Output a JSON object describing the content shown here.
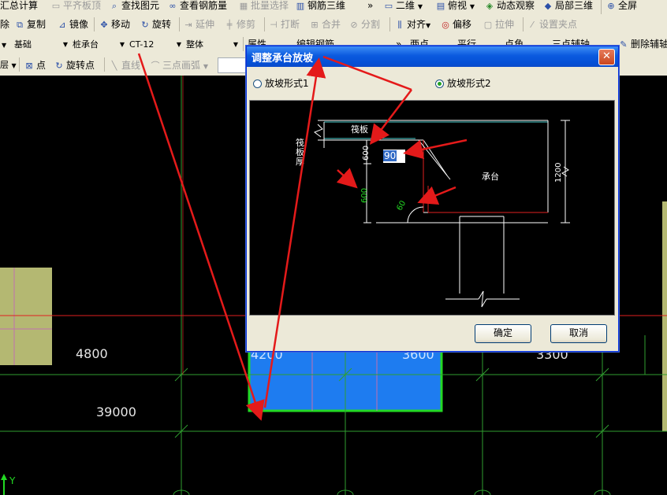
{
  "toolbar1": {
    "items": [
      {
        "label": "汇总计算",
        "icon": "calc-icon",
        "disabled": false
      },
      {
        "label": "平齐板顶",
        "icon": "align-top-icon",
        "disabled": true
      },
      {
        "label": "查找图元",
        "icon": "find-icon",
        "disabled": false
      },
      {
        "label": "查看钢筋量",
        "icon": "rebar-qty-icon",
        "disabled": false
      },
      {
        "label": "批量选择",
        "icon": "batch-select-icon",
        "disabled": true
      },
      {
        "label": "钢筋三维",
        "icon": "rebar-3d-icon",
        "disabled": false
      },
      {
        "label": "二维",
        "icon": "2d-icon",
        "disabled": false
      },
      {
        "label": "俯视",
        "icon": "top-view-icon",
        "disabled": false
      },
      {
        "label": "动态观察",
        "icon": "orbit-icon",
        "disabled": false
      },
      {
        "label": "局部三维",
        "icon": "local-3d-icon",
        "disabled": false
      },
      {
        "label": "全屏",
        "icon": "fullscreen-icon",
        "disabled": false
      }
    ]
  },
  "toolbar2": {
    "items": [
      {
        "label": "除",
        "disabled": false
      },
      {
        "label": "复制",
        "disabled": false
      },
      {
        "label": "镜像",
        "disabled": false
      },
      {
        "label": "移动",
        "disabled": false
      },
      {
        "label": "旋转",
        "disabled": false
      },
      {
        "label": "延伸",
        "disabled": true
      },
      {
        "label": "修剪",
        "disabled": true
      },
      {
        "label": "打断",
        "disabled": true
      },
      {
        "label": "合并",
        "disabled": true
      },
      {
        "label": "分割",
        "disabled": true
      },
      {
        "label": "对齐",
        "disabled": false
      },
      {
        "label": "偏移",
        "disabled": false
      },
      {
        "label": "拉伸",
        "disabled": true
      },
      {
        "label": "设置夹点",
        "disabled": true
      }
    ]
  },
  "toolbar3": {
    "combos": [
      "基础",
      "桩承台",
      "CT-12",
      "整体"
    ],
    "extra": [
      "属性",
      "编辑钢筋",
      "两点",
      "平行",
      "点角",
      "三点辅轴",
      "删除辅轴"
    ]
  },
  "toolbar4": {
    "items": [
      {
        "label": "点",
        "disabled": false
      },
      {
        "label": "旋转点",
        "disabled": false
      },
      {
        "label": "直线",
        "disabled": true
      },
      {
        "label": "三点画弧",
        "disabled": true
      }
    ]
  },
  "canvas": {
    "dims": [
      "4800",
      "39000",
      "4200",
      "3600",
      "3300"
    ],
    "axis_label": "Y",
    "colors": {
      "grid": "#2f9e2f",
      "red_line": "#e02020",
      "pile_cap": "#1e7cf0",
      "panel": "#b4b872"
    }
  },
  "dialog": {
    "title": "调整承台放坡",
    "option1": "放坡形式1",
    "option2": "放坡形式2",
    "selected": "option2",
    "ok": "确定",
    "cancel": "取消",
    "preview": {
      "raft_label": "筏板",
      "thickness_label": "筏板厚",
      "cap_label": "承台",
      "dim_600_top": "600",
      "dim_600_left": "600",
      "dim_1200": "1200",
      "angle_label": "60",
      "angle_input": "90"
    }
  }
}
